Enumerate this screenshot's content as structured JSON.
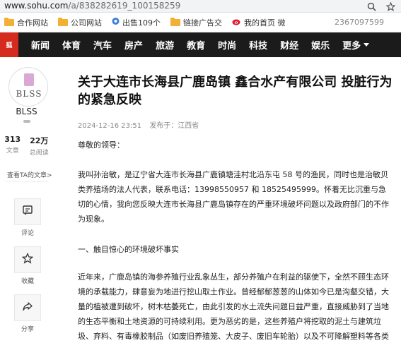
{
  "browser": {
    "url_host": "www.sohu.com",
    "url_path": "/a/838282619_100158259"
  },
  "bookmarks": {
    "items": [
      {
        "label": "合作网站",
        "icon": "folder-icon"
      },
      {
        "label": "公司网站",
        "icon": "folder-icon"
      },
      {
        "label": "出售109个",
        "icon": "page-icon"
      },
      {
        "label": "链接广告交",
        "icon": "folder-icon"
      },
      {
        "label": "我的首页 微",
        "icon": "weibo-icon"
      }
    ],
    "phone": "2367097599"
  },
  "nav": {
    "logo_text": "狐",
    "items": [
      "新闻",
      "体育",
      "汽车",
      "房产",
      "旅游",
      "教育",
      "时尚",
      "科技",
      "财经",
      "娱乐"
    ],
    "more_label": "更多"
  },
  "sidebar": {
    "avatar_brand": "BLSS",
    "author": "BLSS",
    "stats": [
      {
        "value": "313",
        "label": "文章"
      },
      {
        "value": "22万",
        "label": "总阅读"
      }
    ],
    "ta_link": "查看TA的文章>",
    "actions": [
      {
        "label": "评论",
        "icon": "comment-icon"
      },
      {
        "label": "收藏",
        "icon": "star-icon"
      },
      {
        "label": "分享",
        "icon": "share-icon"
      }
    ]
  },
  "article": {
    "title": "关于大连市长海县广鹿岛镇 鑫合水产有限公司 投脏行为的紧急反映",
    "date": "2024-12-16 23:51",
    "source": "发布于：江西省",
    "paragraphs": [
      "尊敬的领导：",
      "我叫孙治敏，是辽宁省大连市长海县广鹿镇塘洼村北沿东屯 58 号的渔民，同时也是治敏贝类养殖场的法人代表，联系电话：13998550957 和 18525495999。怀着无比沉重与急切的心情，我向您反映大连市长海县广鹿岛镇存在的严重环境破坏问题以及政府部门的不作为现象。",
      "一、触目惊心的环境破坏事实",
      "近年来，广鹿岛镇的海参养殖行业乱象丛生，部分养殖户在利益的驱使下，全然不顾生态环境的承载能力，肆意妄为地进行挖山取土作业。曾经郁郁葱葱的山体如今已是沟壑交错，大量的植被遭到破坏，树木枯萎死亡，由此引发的水土流失问题日益严重，直接威胁到了当地的生态平衡和土地资源的可持续利用。更为恶劣的是，这些养殖户将挖取的泥土与建筑垃圾、弃料、有毒橡胶制品（如废旧养殖笼、大皮子、废旧车轮胎）以及不可降解塑料等各类"
    ]
  }
}
